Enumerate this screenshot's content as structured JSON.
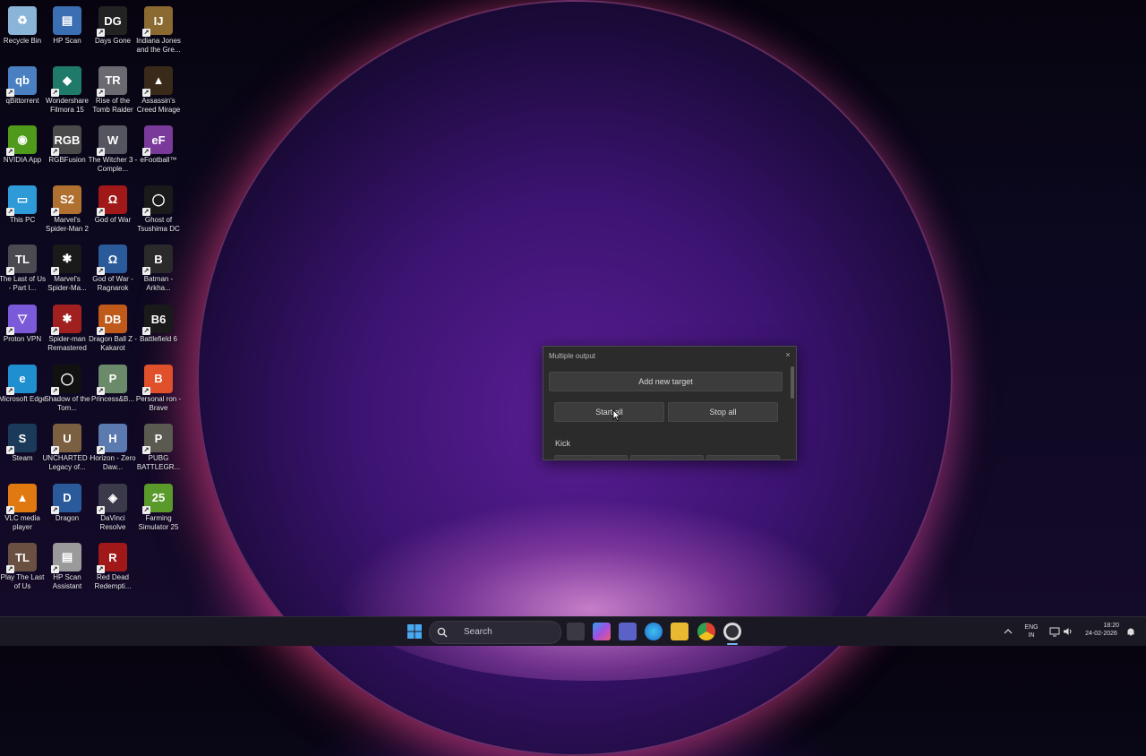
{
  "desktop": {
    "icons": [
      {
        "label": "Recycle Bin",
        "icon": "recycle-bin-icon",
        "color": "#8ab4d8",
        "glyph": "♻"
      },
      {
        "label": "HP Scan",
        "icon": "scanner-icon",
        "color": "#3b6fb3",
        "glyph": "▤"
      },
      {
        "label": "Days Gone",
        "icon": "game-days-gone-icon",
        "color": "#222222",
        "glyph": "DG"
      },
      {
        "label": "Indiana Jones and the Gre...",
        "icon": "game-indiana-jones-icon",
        "color": "#8a6a30",
        "glyph": "IJ"
      },
      {
        "label": "qBittorrent",
        "icon": "qbittorrent-icon",
        "color": "#4a7fc1",
        "glyph": "qb"
      },
      {
        "label": "Wondershare Filmora 15",
        "icon": "filmora-icon",
        "color": "#1f7a6a",
        "glyph": "◆"
      },
      {
        "label": "Rise of the Tomb Raider",
        "icon": "game-tomb-raider-icon",
        "color": "#6a6a70",
        "glyph": "TR"
      },
      {
        "label": "Assassin's Creed Mirage",
        "icon": "game-ac-mirage-icon",
        "color": "#3a2a1a",
        "glyph": "▲"
      },
      {
        "label": "NVIDIA App",
        "icon": "nvidia-icon",
        "color": "#4f9a1a",
        "glyph": "◉"
      },
      {
        "label": "RGBFusion",
        "icon": "rgbfusion-icon",
        "color": "#4a4a4a",
        "glyph": "RGB"
      },
      {
        "label": "The Witcher 3 - Comple...",
        "icon": "game-witcher-icon",
        "color": "#555560",
        "glyph": "W"
      },
      {
        "label": "eFootball™",
        "icon": "game-efootball-icon",
        "color": "#7a3a9a",
        "glyph": "eF"
      },
      {
        "label": "This PC",
        "icon": "this-pc-icon",
        "color": "#2f9ad8",
        "glyph": "▭"
      },
      {
        "label": "Marvel's Spider-Man 2",
        "icon": "game-spiderman2-icon",
        "color": "#b07030",
        "glyph": "S2"
      },
      {
        "label": "God of War",
        "icon": "game-god-of-war-icon",
        "color": "#a01818",
        "glyph": "Ω"
      },
      {
        "label": "Ghost of Tsushima DC",
        "icon": "game-ghost-tsushima-icon",
        "color": "#1a1a1a",
        "glyph": "◯"
      },
      {
        "label": "The Last of Us - Part I...",
        "icon": "game-tlou-icon",
        "color": "#4a4a50",
        "glyph": "TL"
      },
      {
        "label": "Marvel's Spider-Ma...",
        "icon": "game-spiderman-icon",
        "color": "#1a1a1a",
        "glyph": "✱"
      },
      {
        "label": "God of War - Ragnarok",
        "icon": "game-ragnarok-icon",
        "color": "#2a5a9a",
        "glyph": "Ω"
      },
      {
        "label": "Batman - Arkha...",
        "icon": "game-batman-icon",
        "color": "#2a2a2a",
        "glyph": "B"
      },
      {
        "label": "Proton VPN",
        "icon": "proton-vpn-icon",
        "color": "#7a5ad8",
        "glyph": "▽"
      },
      {
        "label": "Spider-man Remastered",
        "icon": "game-spiderman-remastered-icon",
        "color": "#a02020",
        "glyph": "✱"
      },
      {
        "label": "Dragon Ball Z - Kakarot",
        "icon": "game-dbz-icon",
        "color": "#c05a1a",
        "glyph": "DB"
      },
      {
        "label": "Battlefield 6",
        "icon": "game-battlefield-icon",
        "color": "#1a1a1a",
        "glyph": "B6"
      },
      {
        "label": "Microsoft Edge",
        "icon": "edge-icon",
        "color": "#1f8fd0",
        "glyph": "e"
      },
      {
        "label": "Shadow of the Tom...",
        "icon": "game-shadow-tomb-raider-icon",
        "color": "#111111",
        "glyph": "◯"
      },
      {
        "label": "Princess&B...",
        "icon": "princess-icon",
        "color": "#6a8a6a",
        "glyph": "P"
      },
      {
        "label": "Personal ron - Brave",
        "icon": "brave-icon",
        "color": "#e0502a",
        "glyph": "B"
      },
      {
        "label": "Steam",
        "icon": "steam-icon",
        "color": "#1b3a5a",
        "glyph": "S"
      },
      {
        "label": "UNCHARTED - Legacy of...",
        "icon": "game-uncharted-icon",
        "color": "#7a6040",
        "glyph": "U"
      },
      {
        "label": "Horizon - Zero Daw...",
        "icon": "game-horizon-icon",
        "color": "#5a7ab0",
        "glyph": "H"
      },
      {
        "label": "PUBG BATTLEGR...",
        "icon": "game-pubg-icon",
        "color": "#5a5a50",
        "glyph": "P"
      },
      {
        "label": "VLC media player",
        "icon": "vlc-icon",
        "color": "#e07a10",
        "glyph": "▲"
      },
      {
        "label": "Dragon",
        "icon": "dragon-icon",
        "color": "#2a5a9a",
        "glyph": "D"
      },
      {
        "label": "DaVinci Resolve",
        "icon": "davinci-icon",
        "color": "#3a3a4a",
        "glyph": "◈"
      },
      {
        "label": "Farming Simulator 25",
        "icon": "game-farming-sim-icon",
        "color": "#5a9a2a",
        "glyph": "25"
      },
      {
        "label": "Play The Last of Us",
        "icon": "game-play-tlou-icon",
        "color": "#6a5040",
        "glyph": "TL"
      },
      {
        "label": "HP Scan Assistant",
        "icon": "hp-scan-assistant-icon",
        "color": "#9a9a9a",
        "glyph": "▤"
      },
      {
        "label": "Red Dead Redempti...",
        "icon": "game-rdr2-icon",
        "color": "#a01818",
        "glyph": "R"
      }
    ]
  },
  "dialog": {
    "title": "Multiple output",
    "close": "×",
    "add_label": "Add new target",
    "start_label": "Start all",
    "stop_label": "Stop all",
    "section_label": "Kick"
  },
  "taskbar": {
    "search_placeholder": "Search",
    "lang_line1": "ENG",
    "lang_line2": "IN",
    "time": "18:20",
    "date": "24-02-2026"
  }
}
